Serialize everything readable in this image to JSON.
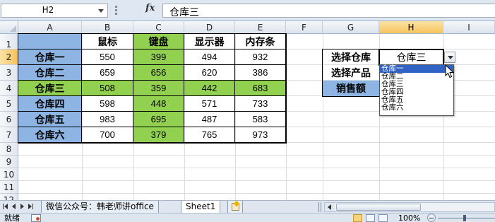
{
  "formula_bar": {
    "name_box": "H2",
    "fx_label": "fx",
    "formula": "仓库三"
  },
  "columns": [
    "A",
    "B",
    "C",
    "D",
    "E",
    "F",
    "G",
    "H",
    "I"
  ],
  "rows": [
    "1",
    "2",
    "3",
    "4",
    "5",
    "6",
    "7",
    "8",
    "9",
    "10",
    "11",
    "12"
  ],
  "table": {
    "headers": [
      "鼠标",
      "键盘",
      "显示器",
      "内存条"
    ],
    "rows": [
      {
        "name": "仓库一",
        "values": [
          "550",
          "399",
          "494",
          "932"
        ]
      },
      {
        "name": "仓库二",
        "values": [
          "659",
          "656",
          "620",
          "386"
        ]
      },
      {
        "name": "仓库三",
        "values": [
          "508",
          "359",
          "442",
          "683"
        ]
      },
      {
        "name": "仓库四",
        "values": [
          "598",
          "448",
          "571",
          "733"
        ]
      },
      {
        "name": "仓库五",
        "values": [
          "983",
          "695",
          "487",
          "583"
        ]
      },
      {
        "name": "仓库六",
        "values": [
          "700",
          "379",
          "765",
          "973"
        ]
      }
    ]
  },
  "lookup": {
    "labels": [
      "选择仓库",
      "选择产品",
      "销售额"
    ],
    "selected_value": "仓库三"
  },
  "dropdown": {
    "options": [
      "仓库一",
      "仓库二",
      "仓库三",
      "仓库四",
      "仓库五",
      "仓库六"
    ],
    "highlighted": "仓库一"
  },
  "sheet_tabs": {
    "tabs": [
      "微信公众号：韩老师讲office",
      "Sheet1"
    ],
    "active": "Sheet1"
  },
  "status_bar": {
    "status": "就绪",
    "zoom": "100%"
  },
  "colors": {
    "name_column_fill": "#8db4e2",
    "highlight_fill": "#92d050",
    "selection_header": "#f6c35c",
    "dropdown_highlight": "#3163c5"
  }
}
